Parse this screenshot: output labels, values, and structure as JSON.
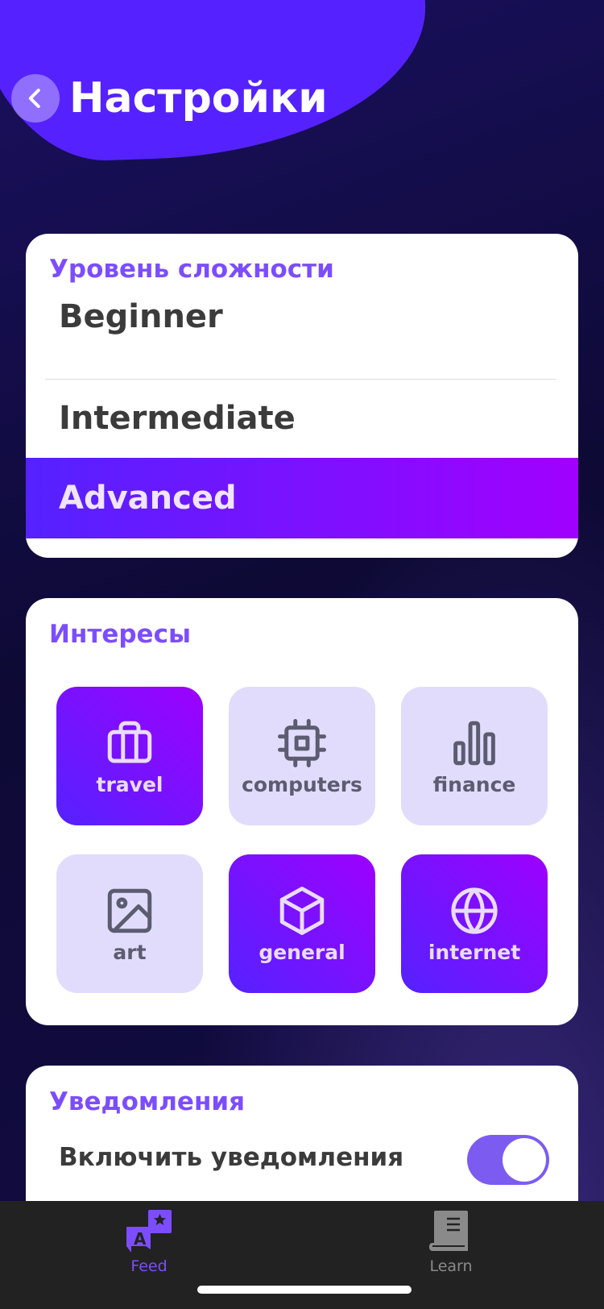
{
  "header": {
    "title": "Настройки",
    "back_icon": "chevron-left-icon"
  },
  "difficulty": {
    "title": "Уровень сложности",
    "options": [
      "Beginner",
      "Intermediate",
      "Advanced"
    ],
    "selected": "Advanced"
  },
  "interests": {
    "title": "Интересы",
    "items": [
      {
        "label": "travel",
        "icon": "briefcase-icon",
        "selected": true
      },
      {
        "label": "computers",
        "icon": "cpu-icon",
        "selected": false
      },
      {
        "label": "finance",
        "icon": "bar-chart-icon",
        "selected": false
      },
      {
        "label": "art",
        "icon": "image-icon",
        "selected": false
      },
      {
        "label": "general",
        "icon": "cube-icon",
        "selected": true
      },
      {
        "label": "internet",
        "icon": "globe-icon",
        "selected": true
      }
    ]
  },
  "notifications": {
    "title": "Уведомления",
    "enable_label": "Включить уведомления",
    "enabled": true
  },
  "tabbar": {
    "tabs": [
      {
        "label": "Feed",
        "icon": "translate-icon",
        "active": true
      },
      {
        "label": "Learn",
        "icon": "book-icon",
        "active": false
      }
    ]
  },
  "colors": {
    "accent": "#5522ff",
    "accent_purple": "#a100ff",
    "section_title": "#7c4dff",
    "tab_active": "#7c4dff",
    "tab_inactive": "#8a8a8a"
  }
}
